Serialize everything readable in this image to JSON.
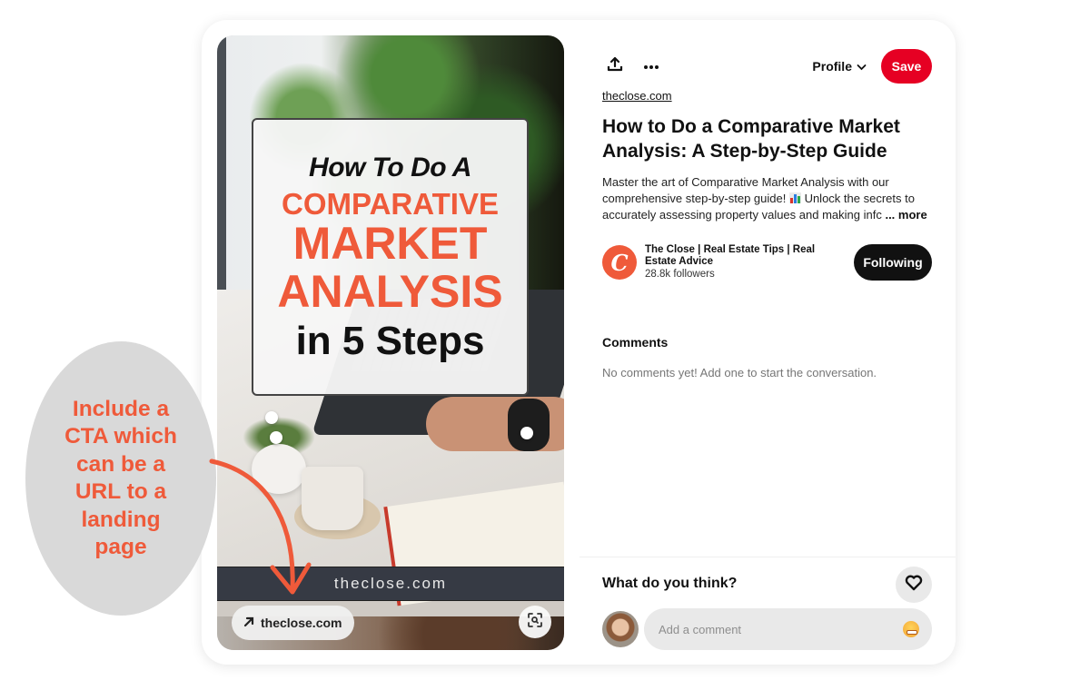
{
  "pin": {
    "image": {
      "overlay_title": {
        "line1": "How To Do A",
        "line2": "COMPARATIVE",
        "line3": "MARKET",
        "line4": "ANALYSIS",
        "line5": "in 5 Steps"
      },
      "url_banner": "theclose.com",
      "link_chip_label": "theclose.com",
      "link_chip_icon": "arrow-up-right-icon",
      "visual_search_icon": "visual-search-icon",
      "accent_color": "#ef5a3a"
    },
    "toolbar": {
      "share_icon": "share-icon",
      "more_icon": "more-icon",
      "profile_label": "Profile",
      "save_label": "Save",
      "save_color": "#e60023"
    },
    "source_link": "theclose.com",
    "title": "How to Do a Comparative Market Analysis: A Step-by-Step Guide",
    "description": {
      "part1": "Master the art of Comparative Market Analysis with our comprehensive step-by-step guide! ",
      "emoji": "bar-chart-emoji",
      "part2": " Unlock the secrets to accurately assessing property values and making infc",
      "more_label": "... more"
    },
    "creator": {
      "avatar_letter": "C",
      "name": "The Close | Real Estate Tips | Real Estate Advice",
      "followers": "28.8k followers",
      "follow_button_label": "Following"
    },
    "comments": {
      "heading": "Comments",
      "empty_text": "No comments yet! Add one to start the conversation."
    },
    "feedback": {
      "question": "What do you think?",
      "react_icon": "heart-icon",
      "comment_placeholder": "Add a comment",
      "emoji_icon": "emoji-icon"
    }
  },
  "annotation": {
    "callout_text": "Include a CTA which can be a URL to a landing page",
    "color": "#ef5a3a",
    "background": "#d9d9d9"
  }
}
